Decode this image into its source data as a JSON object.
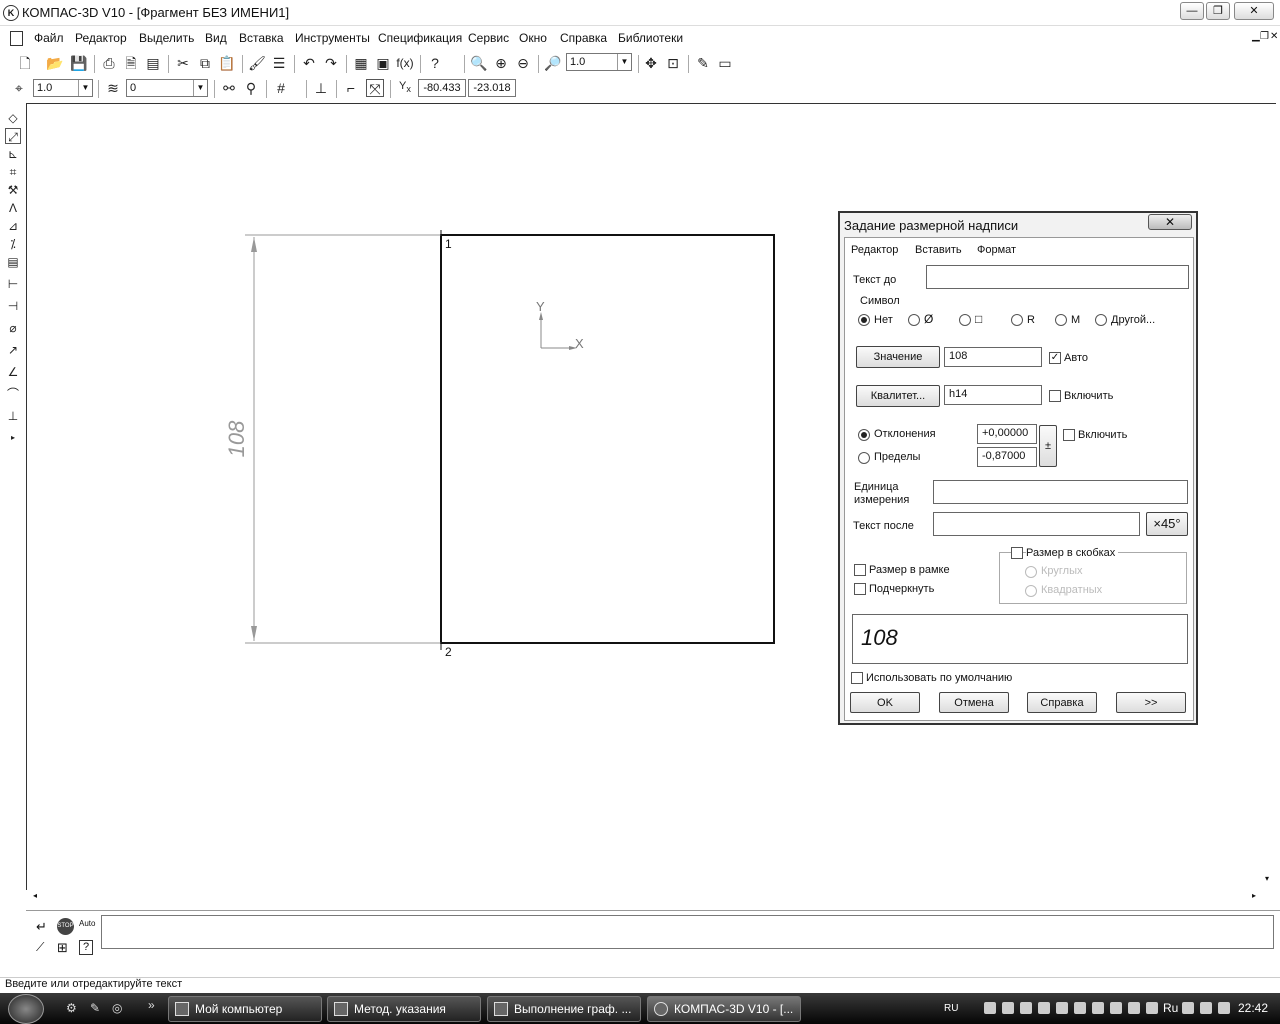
{
  "window": {
    "title": "КОМПАС-3D V10 - [Фрагмент БЕЗ ИМЕНИ1]",
    "logo": "K",
    "minimize": "—",
    "restore": "❐",
    "close": "✕"
  },
  "menu": [
    "Файл",
    "Редактор",
    "Выделить",
    "Вид",
    "Вставка",
    "Инструменты",
    "Спецификация",
    "Сервис",
    "Окно",
    "Справка",
    "Библиотеки"
  ],
  "toolbar1": {
    "zoom_value": "1.0"
  },
  "toolbar2": {
    "step_value": "1.0",
    "layer_value": "0",
    "coord_x": "-80.433",
    "coord_y": "-23.018",
    "yx_label": "Y",
    "yx_sub": "x"
  },
  "canvas": {
    "point1_label": "1",
    "point2_label": "2",
    "dimension_text": "108",
    "axis_y": "Y",
    "axis_x": "X"
  },
  "dialog": {
    "title": "Задание размерной надписи",
    "close_label": "✕",
    "menu": [
      "Редактор",
      "Вставить",
      "Формат"
    ],
    "text_before_label": "Текст до",
    "text_before_value": "",
    "symbol_label": "Символ",
    "symbols": [
      "Нет",
      "Ø",
      "□",
      "R",
      "M",
      "Другой..."
    ],
    "value_button": "Значение",
    "value": "108",
    "auto_label": "Авто",
    "auto_checked": true,
    "qualitet_button": "Квалитет...",
    "qualitet_value": "h14",
    "qualitet_enable_label": "Включить",
    "deviations_label": "Отклонения",
    "limits_label": "Пределы",
    "dev_upper": "+0,00000",
    "dev_lower": "-0,87000",
    "pm_label": "±",
    "dev_enable_label": "Включить",
    "unit_label_1": "Единица",
    "unit_label_2": "измерения",
    "unit_value": "",
    "text_after_label": "Текст после",
    "text_after_value": "",
    "angle_button": "×45°",
    "frame_label": "Размер в рамке",
    "underline_label": "Подчеркнуть",
    "brackets_label": "Размер в скобках",
    "round_label": "Круглых",
    "square_label": "Квадратных",
    "preview": "108",
    "use_default_label": "Использовать по умолчанию",
    "ok": "OK",
    "cancel": "Отмена",
    "help": "Справка",
    "more": ">>"
  },
  "status": {
    "message": "Введите или отредактируйте текст"
  },
  "cmd_panel": {
    "stop_label": "STOP",
    "auto_label": "Auto"
  },
  "taskbar": {
    "tasks": [
      "Мой компьютер",
      "Метод. указания",
      "Выполнение граф. ...",
      "КОМПАС-3D V10 - [..."
    ],
    "lang": "RU",
    "lang2": "Ru",
    "clock": "22:42"
  }
}
